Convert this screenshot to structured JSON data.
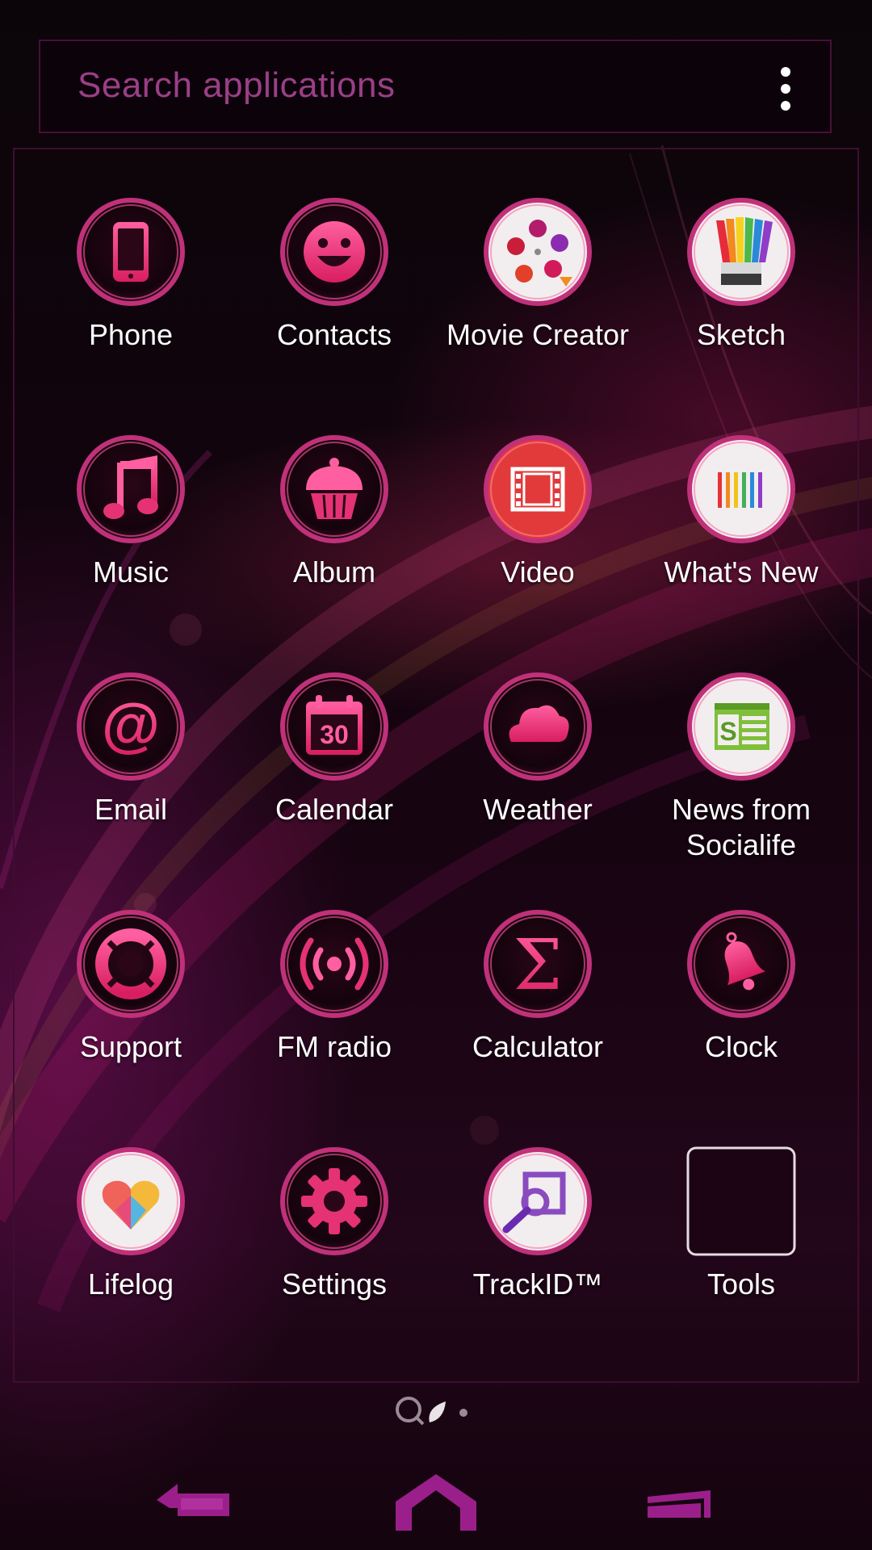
{
  "search": {
    "placeholder": "Search applications",
    "menu_icon": "vertical-ellipsis-icon"
  },
  "theme": {
    "accent": "#e0306f",
    "ring": "#c0317a",
    "frame": "#3f0d33",
    "placeholder_color": "#9a3f86",
    "nav_color": "#9b1f8a"
  },
  "apps": [
    {
      "label": "Phone",
      "icon": "phone-icon"
    },
    {
      "label": "Contacts",
      "icon": "smiley-face-icon"
    },
    {
      "label": "Movie Creator",
      "icon": "film-reel-icon"
    },
    {
      "label": "Sketch",
      "icon": "rainbow-marker-icon"
    },
    {
      "label": "Music",
      "icon": "music-note-icon"
    },
    {
      "label": "Album",
      "icon": "cupcake-icon"
    },
    {
      "label": "Video",
      "icon": "film-strip-icon"
    },
    {
      "label": "What's New",
      "icon": "color-bars-icon"
    },
    {
      "label": "Email",
      "icon": "at-sign-icon"
    },
    {
      "label": "Calendar",
      "icon": "calendar-icon",
      "badge": "30"
    },
    {
      "label": "Weather",
      "icon": "cloud-icon"
    },
    {
      "label": "News from Socialife",
      "label_lines": [
        "News from",
        "Socialife"
      ],
      "icon": "news-s-icon"
    },
    {
      "label": "Support",
      "icon": "lifebuoy-icon"
    },
    {
      "label": "FM radio",
      "icon": "radio-waves-icon"
    },
    {
      "label": "Calculator",
      "icon": "sigma-icon"
    },
    {
      "label": "Clock",
      "icon": "bell-icon"
    },
    {
      "label": "Lifelog",
      "icon": "heart-icon"
    },
    {
      "label": "Settings",
      "icon": "gear-icon"
    },
    {
      "label": "TrackID™",
      "icon": "trackid-search-icon"
    },
    {
      "label": "Tools",
      "icon": "folder-icon"
    }
  ],
  "page_indicator": {
    "icons": [
      "search-page-icon",
      "leaf-page-icon",
      "dot-page-icon"
    ]
  },
  "nav": {
    "back": "back-icon",
    "home": "home-icon",
    "recents": "recents-icon"
  }
}
